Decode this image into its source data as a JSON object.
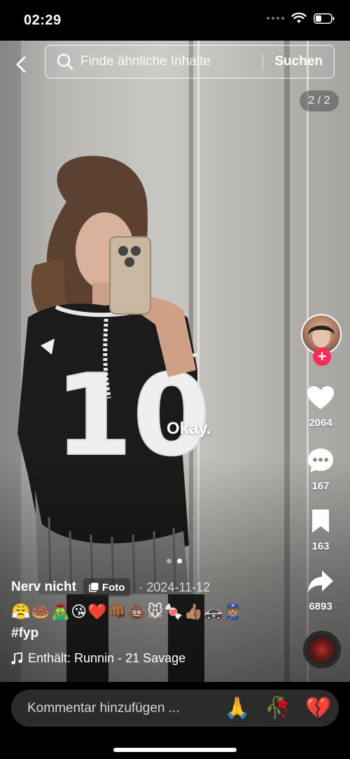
{
  "status_bar": {
    "time": "02:29"
  },
  "header": {
    "search_placeholder": "Finde ähnliche Inhalte",
    "search_button": "Suchen",
    "page_counter": "2 / 2"
  },
  "overlay_text": "Okay.",
  "actions": {
    "likes": "2064",
    "comments": "167",
    "saves": "163",
    "shares": "6893"
  },
  "post": {
    "author": "Nerv nicht",
    "type_badge": "Foto",
    "date": "· 2024-11-12",
    "emoji_caption": "😤🍩🧟‍♂️😘❤️👊🏾💩🐭🍬👍🏽🚓👮🏽‍♂️",
    "hashtag": "#fyp",
    "music": "Enthält: Runnin - 21 Savage"
  },
  "comment_bar": {
    "placeholder": "Kommentar hinzufügen ...",
    "quick_emojis": [
      "🙏",
      "🥀",
      "💔"
    ]
  },
  "colors": {
    "follow": "#fe2c55",
    "comment_bg": "#2b2b2b"
  }
}
